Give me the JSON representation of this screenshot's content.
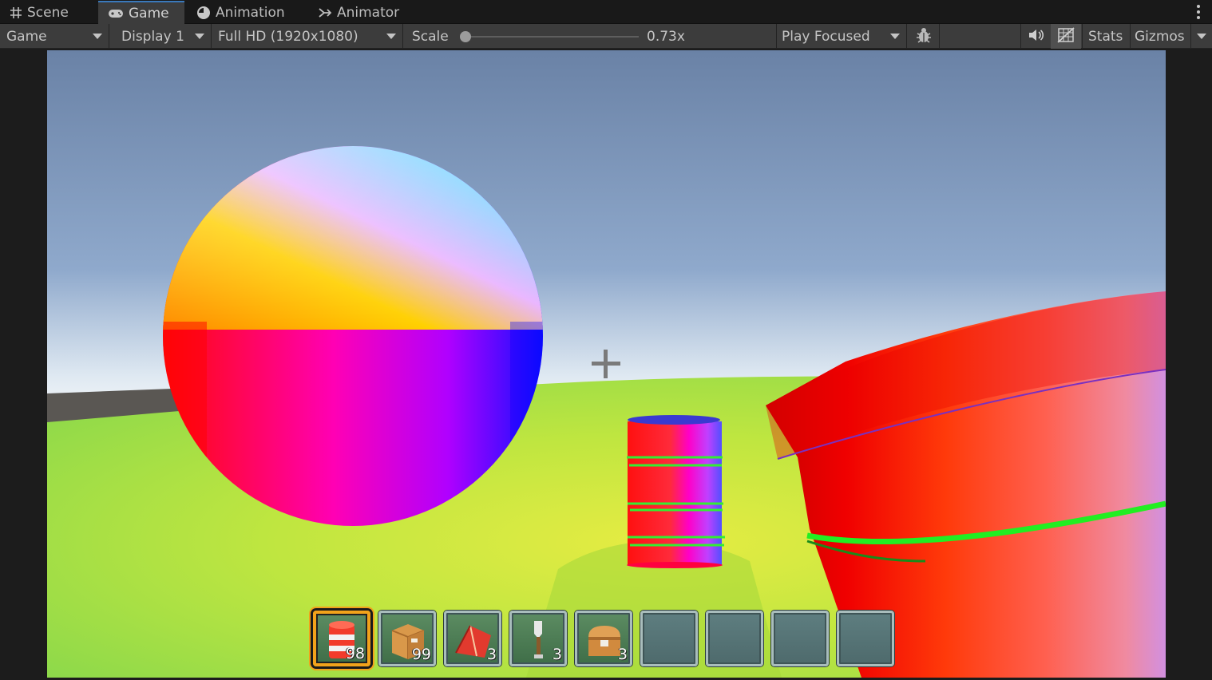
{
  "tabs": [
    {
      "label": "Scene",
      "icon": "grid-icon"
    },
    {
      "label": "Game",
      "icon": "gamepad-icon",
      "active": true
    },
    {
      "label": "Animation",
      "icon": "animation-clock-icon"
    },
    {
      "label": "Animator",
      "icon": "animator-icon"
    }
  ],
  "toolbar": {
    "view_mode": "Game",
    "display": "Display 1",
    "resolution": "Full HD (1920x1080)",
    "scale_label": "Scale",
    "scale_value": "0.73x",
    "scale_level": 0.0,
    "play_mode": "Play Focused",
    "stats": "Stats",
    "gizmos": "Gizmos"
  },
  "hotbar": {
    "selected_index": 0,
    "slots": [
      {
        "item": "barrel-icon",
        "count": "98"
      },
      {
        "item": "crate-icon",
        "count": "99"
      },
      {
        "item": "tent-icon",
        "count": "3"
      },
      {
        "item": "shovel-icon",
        "count": "3"
      },
      {
        "item": "chest-icon",
        "count": "3"
      },
      {
        "item": "",
        "count": ""
      },
      {
        "item": "",
        "count": ""
      },
      {
        "item": "",
        "count": ""
      },
      {
        "item": "",
        "count": ""
      }
    ]
  },
  "colors": {
    "accent_tab": "#3a79bb",
    "hotbar_selected": "#f2a21b",
    "toolbar_bg": "#3c3c3c"
  }
}
